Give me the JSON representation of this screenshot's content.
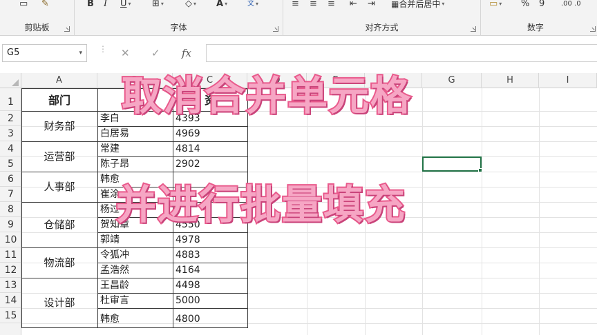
{
  "ribbon": {
    "groups": [
      {
        "label": "剪贴板"
      },
      {
        "label": "字体"
      },
      {
        "label": "对齐方式"
      },
      {
        "label": "数字"
      }
    ],
    "merge_button_label": "合并后居中",
    "percent_label": "%",
    "comma_label": "9",
    "decimal_label": ".00  .0"
  },
  "formula_bar": {
    "name_box": "G5",
    "fx_label": "fx",
    "cancel_icon": "x-icon",
    "enter_icon": "check-icon",
    "value": ""
  },
  "columns": [
    "A",
    "B",
    "C",
    "D",
    "E",
    "F",
    "G",
    "H",
    "I"
  ],
  "rows": [
    "1",
    "2",
    "3",
    "4",
    "5",
    "6",
    "7",
    "8",
    "9",
    "10",
    "11",
    "12",
    "13",
    "14",
    "15"
  ],
  "table": {
    "header": {
      "dept": "部门",
      "name": "",
      "salary": "资"
    },
    "departments": [
      {
        "name": "财务部"
      },
      {
        "name": "运营部"
      },
      {
        "name": "人事部"
      },
      {
        "name": "仓储部"
      },
      {
        "name": "物流部"
      },
      {
        "name": "设计部"
      }
    ],
    "records": [
      {
        "name": "李白",
        "salary": "4393"
      },
      {
        "name": "白居易",
        "salary": "4969"
      },
      {
        "name": "常建",
        "salary": "4814"
      },
      {
        "name": "陈子昂",
        "salary": "2902"
      },
      {
        "name": "韩愈",
        "salary": ""
      },
      {
        "name": "崔涂",
        "salary": ""
      },
      {
        "name": "杨过",
        "salary": ""
      },
      {
        "name": "贺知章",
        "salary": "4550"
      },
      {
        "name": "郭靖",
        "salary": "4978"
      },
      {
        "name": "令狐冲",
        "salary": "4883"
      },
      {
        "name": "孟浩然",
        "salary": "4164"
      },
      {
        "name": "王昌龄",
        "salary": "4498"
      },
      {
        "name": "杜审言",
        "salary": "5000"
      },
      {
        "name": "韩愈",
        "salary": "4800"
      }
    ]
  },
  "overlay": {
    "line1": "取消合并单元格",
    "line2": "并进行批量填充"
  },
  "colors": {
    "accent": "#217346",
    "caption_fill": "#f6a6c4",
    "caption_stroke": "#e95a8c"
  }
}
